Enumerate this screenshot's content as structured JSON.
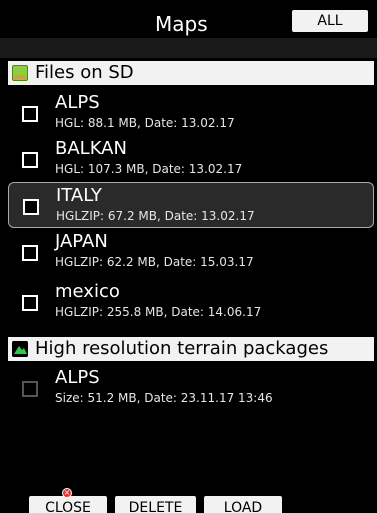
{
  "header": {
    "title": "Maps",
    "all_label": "ALL"
  },
  "sections": {
    "files_on_sd": "Files on SD",
    "terrain": "High resolution terrain packages"
  },
  "files": [
    {
      "name": "ALPS",
      "info": "HGL: 88.1 MB, Date: 13.02.17"
    },
    {
      "name": "BALKAN",
      "info": "HGL: 107.3 MB, Date: 13.02.17"
    },
    {
      "name": "ITALY",
      "info": "HGLZIP: 67.2 MB, Date: 13.02.17"
    },
    {
      "name": "JAPAN",
      "info": "HGLZIP: 62.2 MB, Date: 15.03.17"
    },
    {
      "name": "mexico",
      "info": "HGLZIP: 255.8 MB, Date: 14.06.17"
    }
  ],
  "terrain_packages": [
    {
      "name": "ALPS",
      "info": "Size: 51.2 MB, Date: 23.11.17 13:46"
    }
  ],
  "buttons": {
    "close": "CLOSE",
    "delete": "DELETE",
    "load": "LOAD"
  },
  "icons": {
    "sd_card": "sd-card-icon",
    "terrain": "terrain-icon",
    "close_badge": "close-badge-icon",
    "checkbox": "checkbox-icon"
  },
  "colors": {
    "background": "#000000",
    "selected_row": "#2a2a2a",
    "section_header": "#f2f2f2",
    "button": "#f2f2f2",
    "sd_icon": "#8fce3f",
    "terrain_icon": "#2ecc40",
    "close_badge": "#e83030"
  }
}
